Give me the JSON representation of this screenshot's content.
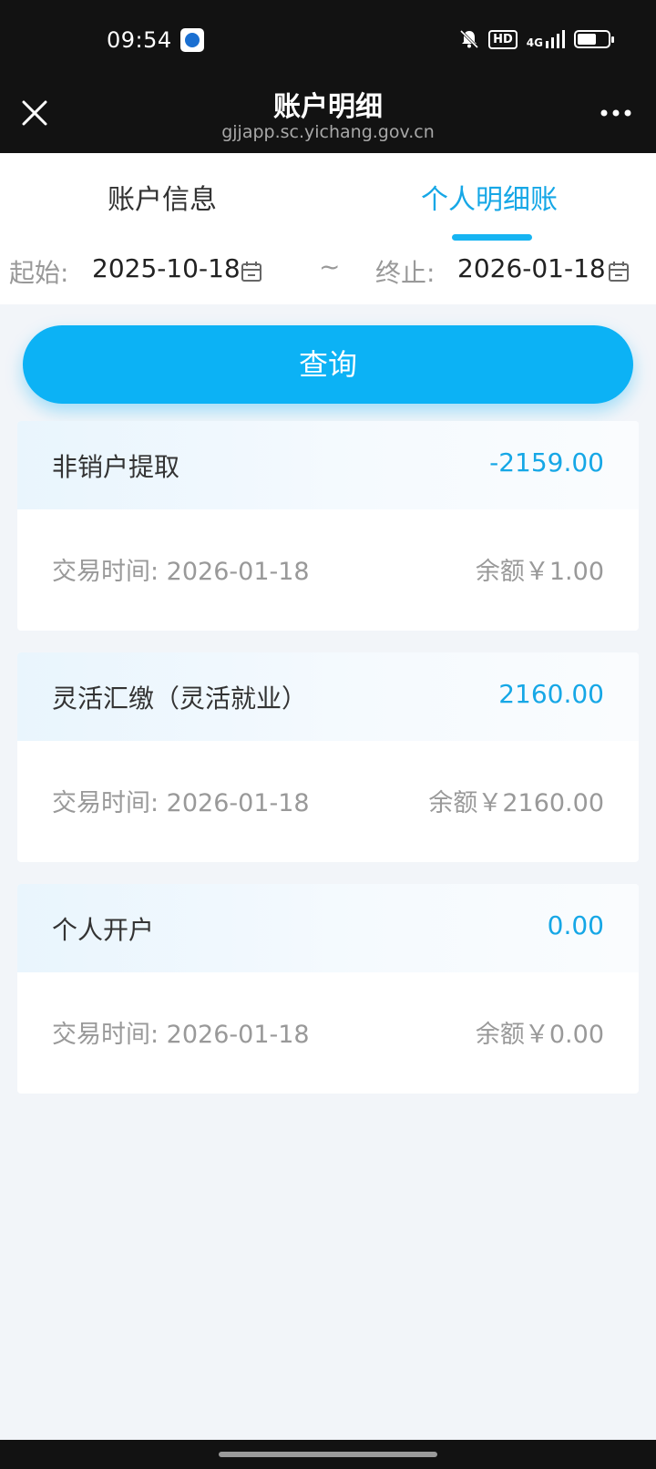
{
  "status_bar": {
    "time": "09:54",
    "hd_label": "HD",
    "signal_label": "4G"
  },
  "title_bar": {
    "title": "账户明细",
    "subtitle": "gjjapp.sc.yichang.gov.cn"
  },
  "tabs": [
    {
      "label": "账户信息",
      "active": false
    },
    {
      "label": "个人明细账",
      "active": true
    }
  ],
  "date_range": {
    "start_label": "起始:",
    "start_value": "2025-10-18",
    "separator": "~",
    "end_label": "终止:",
    "end_value": "2026-01-18"
  },
  "query_button": {
    "label": "查询"
  },
  "records": [
    {
      "type": "非销户提取",
      "amount": "-2159.00",
      "date": "交易时间: 2026-01-18",
      "balance": "余额￥1.00"
    },
    {
      "type": "灵活汇缴（灵活就业）",
      "amount": "2160.00",
      "date": "交易时间: 2026-01-18",
      "balance": "余额￥2160.00"
    },
    {
      "type": "个人开户",
      "amount": "0.00",
      "date": "交易时间: 2026-01-18",
      "balance": "余额￥0.00"
    }
  ],
  "colors": {
    "accent": "#16a7e6",
    "button": "#0cb2f5",
    "header_bg": "#121212",
    "page_bg": "#f2f5f9"
  }
}
